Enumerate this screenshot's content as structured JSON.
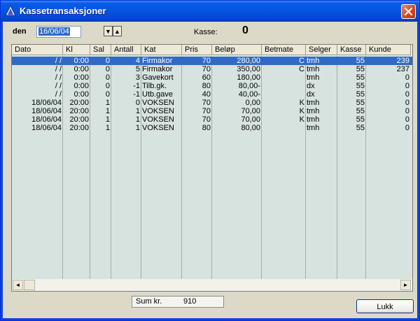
{
  "window": {
    "title": "Kassetransaksjoner",
    "accent": "#0a5ce8",
    "close_color": "#d2461f"
  },
  "filter": {
    "den_label": "den",
    "date_value": "16/06/04",
    "spin_down": "▼",
    "spin_up": "▲",
    "kasse_label": "Kasse:",
    "kasse_value": "0"
  },
  "table": {
    "columns": [
      "Dato",
      "Kl",
      "Sal",
      "Antall",
      "Kat",
      "Pris",
      "Beløp",
      "Betmate",
      "Selger",
      "Kasse",
      "Kunde"
    ],
    "rows": [
      {
        "selected": true,
        "cells": [
          " /  /",
          "0:00",
          "0",
          "4",
          "Firmakor",
          "70",
          "280,00",
          "C",
          "tmh",
          "55",
          "239"
        ]
      },
      {
        "selected": false,
        "cells": [
          " /  /",
          "0:00",
          "0",
          "5",
          "Firmakor",
          "70",
          "350,00",
          "C",
          "tmh",
          "55",
          "237"
        ]
      },
      {
        "selected": false,
        "cells": [
          " /  /",
          "0:00",
          "0",
          "3",
          "Gavekort",
          "60",
          "180,00",
          "",
          "tmh",
          "55",
          "0"
        ]
      },
      {
        "selected": false,
        "cells": [
          " /  /",
          "0:00",
          "0",
          "-1",
          "Tilb.gk.",
          "80",
          "80,00-",
          "",
          "dx",
          "55",
          "0"
        ]
      },
      {
        "selected": false,
        "cells": [
          " /  /",
          "0:00",
          "0",
          "-1",
          "Utb.gave",
          "40",
          "40,00-",
          "",
          "dx",
          "55",
          "0"
        ]
      },
      {
        "selected": false,
        "cells": [
          "18/06/04",
          "20:00",
          "1",
          "0",
          "VOKSEN",
          "70",
          "0,00",
          "K",
          "tmh",
          "55",
          "0"
        ]
      },
      {
        "selected": false,
        "cells": [
          "18/06/04",
          "20:00",
          "1",
          "1",
          "VOKSEN",
          "70",
          "70,00",
          "K",
          "tmh",
          "55",
          "0"
        ]
      },
      {
        "selected": false,
        "cells": [
          "18/06/04",
          "20:00",
          "1",
          "1",
          "VOKSEN",
          "70",
          "70,00",
          "K",
          "tmh",
          "55",
          "0"
        ]
      },
      {
        "selected": false,
        "cells": [
          "18/06/04",
          "20:00",
          "1",
          "1",
          "VOKSEN",
          "80",
          "80,00",
          "",
          "tmh",
          "55",
          "0"
        ]
      }
    ],
    "scroll_left": "◄",
    "scroll_right": "►"
  },
  "footer": {
    "sum_label": "Sum kr.",
    "sum_value": "910",
    "close_button": "Lukk"
  }
}
